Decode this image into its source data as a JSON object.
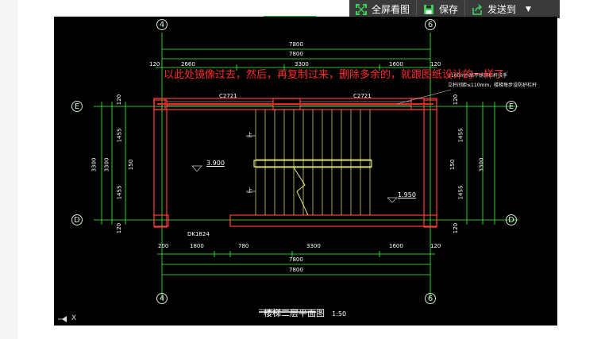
{
  "toolbar": {
    "fullscreen_label": "全屏看图",
    "save_label": "保存",
    "send_label": "发送到"
  },
  "drawing": {
    "axes": {
      "axis_4": "4",
      "axis_6": "6",
      "axis_E": "E",
      "axis_D": "D"
    },
    "dims_top": {
      "overall_1": "7800",
      "overall_2": "7800",
      "left_end": "120",
      "seg_1": "2660",
      "seg_2": "3300",
      "seg_3": "1600",
      "right_end": "120"
    },
    "dims_bottom": {
      "left_end": "200",
      "seg_1": "1800",
      "seg_2": "780",
      "seg_3": "3300",
      "seg_4": "1600",
      "right_end": "120",
      "overall_1": "7800",
      "overall_2": "7800"
    },
    "dims_left": {
      "top_120": "120",
      "seg_1455_a": "1455",
      "seg_150": "150",
      "seg_1455_b": "1455",
      "bottom_120": "120",
      "total": "3300",
      "total_inner": "3300"
    },
    "dims_right": {
      "top_120": "120",
      "seg_1455_a": "1455",
      "seg_150": "150",
      "seg_1455_b": "1455",
      "bottom_120": "120",
      "total": "3300"
    },
    "window_left": "C2721",
    "window_right": "C2721",
    "door_label": "DK1824",
    "level_1": "3.900",
    "level_2": "1.950",
    "up_mark_1": "上",
    "up_mark_2": "上",
    "callout_1": "1100mm高不锈钢栏杆扶手",
    "callout_2": "立杆间距≤110mm，楼梯每步设防护栏杆",
    "title": "楼梯二层平面图",
    "scale": "1:50"
  },
  "annotation": {
    "text": "以此处镜像过去，然后，再复制过来，删除多余的，就跟图纸设计的一样了"
  },
  "colors": {
    "wall": "#ff3b3b",
    "dim_line": "#39ff39",
    "stair": "#e8e87a",
    "note": "#ff2a2a"
  }
}
